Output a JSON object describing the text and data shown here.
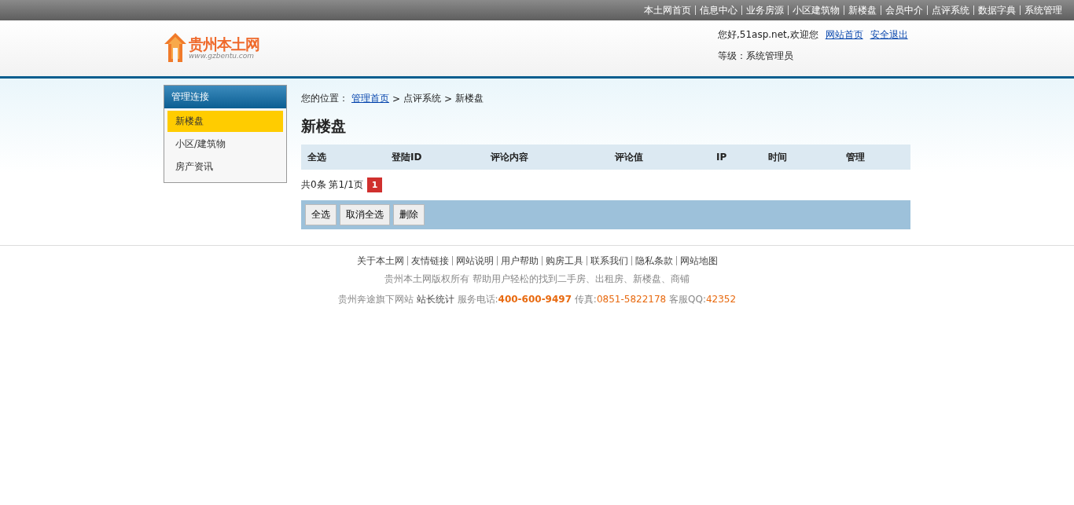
{
  "top_nav": [
    "本土网首页",
    "信息中心",
    "业务房源",
    "小区建筑物",
    "新楼盘",
    "会员中介",
    "点评系统",
    "数据字典",
    "系统管理"
  ],
  "logo": {
    "name": "贵州本土网",
    "url": "www.gzbentu.com"
  },
  "user": {
    "greeting": "您好,51asp.net,欢迎您",
    "links": [
      "网站首页",
      "安全退出"
    ],
    "level": "等级：系统管理员"
  },
  "sidebar": {
    "title": "管理连接",
    "items": [
      {
        "label": "新楼盘",
        "selected": true
      },
      {
        "label": "小区/建筑物",
        "selected": false
      },
      {
        "label": "房产资讯",
        "selected": false
      }
    ]
  },
  "breadcrumb": {
    "prefix": "您的位置：",
    "link": "管理首页",
    "separator": ">",
    "rest": [
      "点评系统",
      "新楼盘"
    ]
  },
  "page_title": "新楼盘",
  "table": {
    "columns": [
      "全选",
      "登陆ID",
      "评论内容",
      "评论值",
      "IP",
      "时间",
      "管理"
    ]
  },
  "pagination": {
    "summary": "共0条 第1/1页",
    "pages": [
      {
        "label": "1",
        "selected": true
      }
    ]
  },
  "actions": [
    "全选",
    "取消全选",
    "删除"
  ],
  "footer": {
    "links": [
      "关于本土网",
      "友情链接",
      "网站说明",
      "用户帮助",
      "购房工具",
      "联系我们",
      "隐私条款",
      "网站地图"
    ],
    "copyright": "贵州本土网版权所有 帮助用户轻松的找到二手房、出租房、新楼盘、商铺",
    "contact": [
      {
        "kind": "plain",
        "text": "贵州奔途旗下网站"
      },
      {
        "kind": "strong",
        "text": "站长统计"
      },
      {
        "kind": "plain",
        "text": "服务电话:"
      },
      {
        "kind": "highlight",
        "text": "400-600-9497"
      },
      {
        "kind": "plain",
        "text": "传真:"
      },
      {
        "kind": "accent",
        "text": "0851-5822178"
      },
      {
        "kind": "plain",
        "text": "客服QQ:"
      },
      {
        "kind": "accent",
        "text": "42352"
      }
    ]
  }
}
